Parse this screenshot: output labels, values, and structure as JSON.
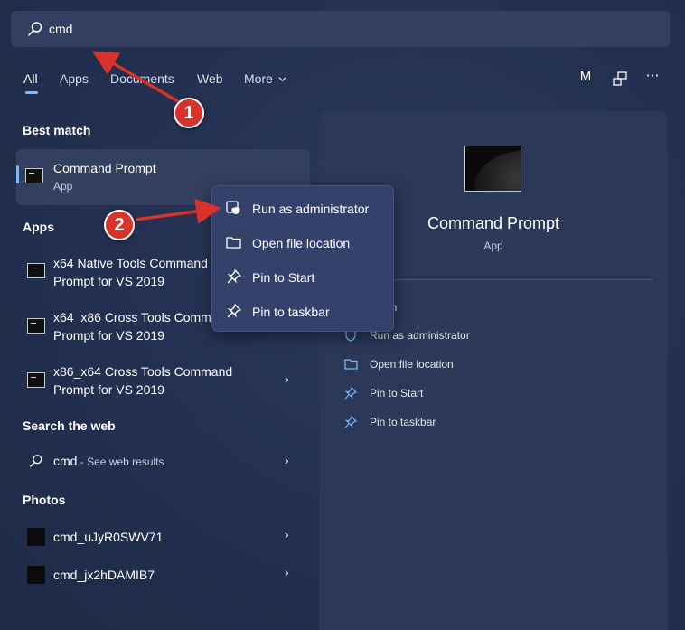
{
  "search": {
    "value": "cmd"
  },
  "tabs": [
    {
      "label": "All",
      "active": true
    },
    {
      "label": "Apps"
    },
    {
      "label": "Documents"
    },
    {
      "label": "Web"
    },
    {
      "label": "More"
    }
  ],
  "header": {
    "account_initial": "M"
  },
  "best_match": {
    "heading": "Best match",
    "title": "Command Prompt",
    "subtitle": "App"
  },
  "apps": {
    "heading": "Apps",
    "items": [
      {
        "line1": "x64 Native Tools Command",
        "line2": "Prompt for VS 2019"
      },
      {
        "line1": "x64_x86 Cross Tools Comma",
        "line2": "Prompt for VS 2019"
      },
      {
        "line1": "x86_x64 Cross Tools Command",
        "line2": "Prompt for VS 2019"
      }
    ]
  },
  "web": {
    "heading": "Search the web",
    "query": "cmd",
    "suffix": " - See web results"
  },
  "photos": {
    "heading": "Photos",
    "items": [
      "cmd_uJyR0SWV71",
      "cmd_jx2hDAMIB7"
    ]
  },
  "panel": {
    "title": "Command Prompt",
    "subtitle": "App",
    "open_partial": "en",
    "actions": [
      "Run as administrator",
      "Open file location",
      "Pin to Start",
      "Pin to taskbar"
    ]
  },
  "context_menu": {
    "items": [
      "Run as administrator",
      "Open file location",
      "Pin to Start",
      "Pin to taskbar"
    ]
  },
  "annotations": {
    "badge1": "1",
    "badge2": "2",
    "color": "#d8322b"
  },
  "colors": {
    "accent": "#7ab8ff",
    "background": "#243152",
    "panel": "#2c3858"
  }
}
